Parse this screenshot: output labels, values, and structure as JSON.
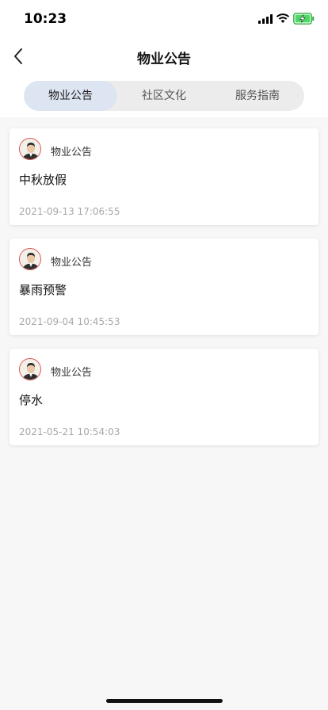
{
  "status": {
    "time": "10:23"
  },
  "header": {
    "title": "物业公告",
    "back_icon": "chevron-left-icon"
  },
  "tabs": [
    {
      "label": "物业公告",
      "active": true
    },
    {
      "label": "社区文化",
      "active": false
    },
    {
      "label": "服务指南",
      "active": false
    }
  ],
  "notices": [
    {
      "source": "物业公告",
      "title": "中秋放假",
      "time": "2021-09-13 17:06:55"
    },
    {
      "source": "物业公告",
      "title": "暴雨预警",
      "time": "2021-09-04 10:45:53"
    },
    {
      "source": "物业公告",
      "title": "停水",
      "time": "2021-05-21 10:54:03"
    }
  ],
  "colors": {
    "active_tab_bg": "#dde4f2",
    "tab_track_bg": "#ececec",
    "avatar_border": "#d9534f",
    "battery_green": "#4cd964"
  }
}
